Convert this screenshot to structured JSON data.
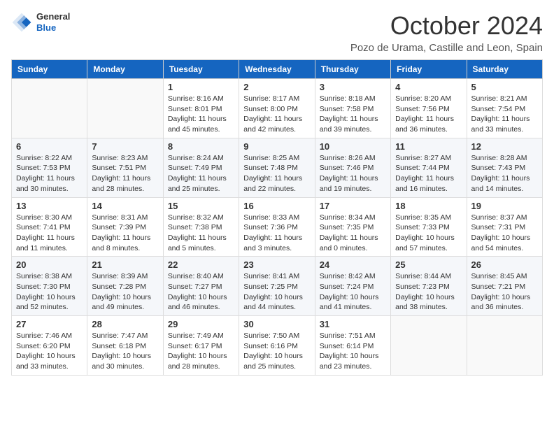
{
  "header": {
    "logo_general": "General",
    "logo_blue": "Blue",
    "month": "October 2024",
    "location": "Pozo de Urama, Castille and Leon, Spain"
  },
  "weekdays": [
    "Sunday",
    "Monday",
    "Tuesday",
    "Wednesday",
    "Thursday",
    "Friday",
    "Saturday"
  ],
  "weeks": [
    [
      {
        "day": "",
        "sunrise": "",
        "sunset": "",
        "daylight": ""
      },
      {
        "day": "",
        "sunrise": "",
        "sunset": "",
        "daylight": ""
      },
      {
        "day": "1",
        "sunrise": "Sunrise: 8:16 AM",
        "sunset": "Sunset: 8:01 PM",
        "daylight": "Daylight: 11 hours and 45 minutes."
      },
      {
        "day": "2",
        "sunrise": "Sunrise: 8:17 AM",
        "sunset": "Sunset: 8:00 PM",
        "daylight": "Daylight: 11 hours and 42 minutes."
      },
      {
        "day": "3",
        "sunrise": "Sunrise: 8:18 AM",
        "sunset": "Sunset: 7:58 PM",
        "daylight": "Daylight: 11 hours and 39 minutes."
      },
      {
        "day": "4",
        "sunrise": "Sunrise: 8:20 AM",
        "sunset": "Sunset: 7:56 PM",
        "daylight": "Daylight: 11 hours and 36 minutes."
      },
      {
        "day": "5",
        "sunrise": "Sunrise: 8:21 AM",
        "sunset": "Sunset: 7:54 PM",
        "daylight": "Daylight: 11 hours and 33 minutes."
      }
    ],
    [
      {
        "day": "6",
        "sunrise": "Sunrise: 8:22 AM",
        "sunset": "Sunset: 7:53 PM",
        "daylight": "Daylight: 11 hours and 30 minutes."
      },
      {
        "day": "7",
        "sunrise": "Sunrise: 8:23 AM",
        "sunset": "Sunset: 7:51 PM",
        "daylight": "Daylight: 11 hours and 28 minutes."
      },
      {
        "day": "8",
        "sunrise": "Sunrise: 8:24 AM",
        "sunset": "Sunset: 7:49 PM",
        "daylight": "Daylight: 11 hours and 25 minutes."
      },
      {
        "day": "9",
        "sunrise": "Sunrise: 8:25 AM",
        "sunset": "Sunset: 7:48 PM",
        "daylight": "Daylight: 11 hours and 22 minutes."
      },
      {
        "day": "10",
        "sunrise": "Sunrise: 8:26 AM",
        "sunset": "Sunset: 7:46 PM",
        "daylight": "Daylight: 11 hours and 19 minutes."
      },
      {
        "day": "11",
        "sunrise": "Sunrise: 8:27 AM",
        "sunset": "Sunset: 7:44 PM",
        "daylight": "Daylight: 11 hours and 16 minutes."
      },
      {
        "day": "12",
        "sunrise": "Sunrise: 8:28 AM",
        "sunset": "Sunset: 7:43 PM",
        "daylight": "Daylight: 11 hours and 14 minutes."
      }
    ],
    [
      {
        "day": "13",
        "sunrise": "Sunrise: 8:30 AM",
        "sunset": "Sunset: 7:41 PM",
        "daylight": "Daylight: 11 hours and 11 minutes."
      },
      {
        "day": "14",
        "sunrise": "Sunrise: 8:31 AM",
        "sunset": "Sunset: 7:39 PM",
        "daylight": "Daylight: 11 hours and 8 minutes."
      },
      {
        "day": "15",
        "sunrise": "Sunrise: 8:32 AM",
        "sunset": "Sunset: 7:38 PM",
        "daylight": "Daylight: 11 hours and 5 minutes."
      },
      {
        "day": "16",
        "sunrise": "Sunrise: 8:33 AM",
        "sunset": "Sunset: 7:36 PM",
        "daylight": "Daylight: 11 hours and 3 minutes."
      },
      {
        "day": "17",
        "sunrise": "Sunrise: 8:34 AM",
        "sunset": "Sunset: 7:35 PM",
        "daylight": "Daylight: 11 hours and 0 minutes."
      },
      {
        "day": "18",
        "sunrise": "Sunrise: 8:35 AM",
        "sunset": "Sunset: 7:33 PM",
        "daylight": "Daylight: 10 hours and 57 minutes."
      },
      {
        "day": "19",
        "sunrise": "Sunrise: 8:37 AM",
        "sunset": "Sunset: 7:31 PM",
        "daylight": "Daylight: 10 hours and 54 minutes."
      }
    ],
    [
      {
        "day": "20",
        "sunrise": "Sunrise: 8:38 AM",
        "sunset": "Sunset: 7:30 PM",
        "daylight": "Daylight: 10 hours and 52 minutes."
      },
      {
        "day": "21",
        "sunrise": "Sunrise: 8:39 AM",
        "sunset": "Sunset: 7:28 PM",
        "daylight": "Daylight: 10 hours and 49 minutes."
      },
      {
        "day": "22",
        "sunrise": "Sunrise: 8:40 AM",
        "sunset": "Sunset: 7:27 PM",
        "daylight": "Daylight: 10 hours and 46 minutes."
      },
      {
        "day": "23",
        "sunrise": "Sunrise: 8:41 AM",
        "sunset": "Sunset: 7:25 PM",
        "daylight": "Daylight: 10 hours and 44 minutes."
      },
      {
        "day": "24",
        "sunrise": "Sunrise: 8:42 AM",
        "sunset": "Sunset: 7:24 PM",
        "daylight": "Daylight: 10 hours and 41 minutes."
      },
      {
        "day": "25",
        "sunrise": "Sunrise: 8:44 AM",
        "sunset": "Sunset: 7:23 PM",
        "daylight": "Daylight: 10 hours and 38 minutes."
      },
      {
        "day": "26",
        "sunrise": "Sunrise: 8:45 AM",
        "sunset": "Sunset: 7:21 PM",
        "daylight": "Daylight: 10 hours and 36 minutes."
      }
    ],
    [
      {
        "day": "27",
        "sunrise": "Sunrise: 7:46 AM",
        "sunset": "Sunset: 6:20 PM",
        "daylight": "Daylight: 10 hours and 33 minutes."
      },
      {
        "day": "28",
        "sunrise": "Sunrise: 7:47 AM",
        "sunset": "Sunset: 6:18 PM",
        "daylight": "Daylight: 10 hours and 30 minutes."
      },
      {
        "day": "29",
        "sunrise": "Sunrise: 7:49 AM",
        "sunset": "Sunset: 6:17 PM",
        "daylight": "Daylight: 10 hours and 28 minutes."
      },
      {
        "day": "30",
        "sunrise": "Sunrise: 7:50 AM",
        "sunset": "Sunset: 6:16 PM",
        "daylight": "Daylight: 10 hours and 25 minutes."
      },
      {
        "day": "31",
        "sunrise": "Sunrise: 7:51 AM",
        "sunset": "Sunset: 6:14 PM",
        "daylight": "Daylight: 10 hours and 23 minutes."
      },
      {
        "day": "",
        "sunrise": "",
        "sunset": "",
        "daylight": ""
      },
      {
        "day": "",
        "sunrise": "",
        "sunset": "",
        "daylight": ""
      }
    ]
  ]
}
